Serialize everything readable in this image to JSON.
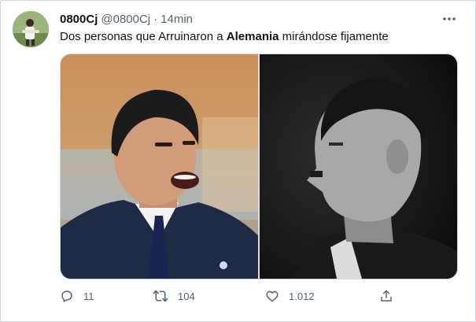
{
  "tweet": {
    "author_name": "0800Cj",
    "author_handle": "@0800Cj",
    "separator": "·",
    "timestamp": "14min",
    "text_before": "Dos personas que Arruinaron a ",
    "text_bold": "Alemania",
    "text_after": " mirándose fijamente"
  },
  "actions": {
    "reply_count": "11",
    "retweet_count": "104",
    "like_count": "1.012"
  },
  "icons": {
    "more": "more-icon",
    "reply": "reply-icon",
    "retweet": "retweet-icon",
    "like": "like-icon",
    "share": "share-icon"
  },
  "colors": {
    "text_primary": "#0f1419",
    "text_secondary": "#536471",
    "border": "#cfd9de"
  }
}
